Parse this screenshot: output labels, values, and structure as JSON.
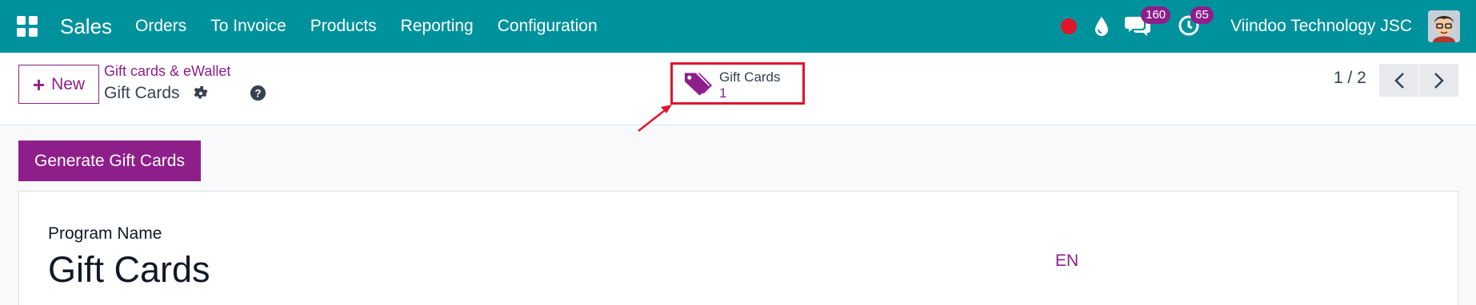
{
  "navbar": {
    "app_name": "Sales",
    "menu": [
      "Orders",
      "To Invoice",
      "Products",
      "Reporting",
      "Configuration"
    ],
    "messages_badge": "160",
    "activities_badge": "65",
    "company": "Viindoo Technology JSC"
  },
  "control_panel": {
    "new_label": "New",
    "breadcrumb_parent": "Gift cards & eWallet",
    "breadcrumb_current": "Gift Cards",
    "smart_button": {
      "label": "Gift Cards",
      "value": "1"
    },
    "pager": "1 / 2"
  },
  "form": {
    "generate_button": "Generate Gift Cards",
    "program_name_label": "Program Name",
    "program_name_value": "Gift Cards",
    "language": "EN"
  },
  "colors": {
    "navbar": "#00929c",
    "primary": "#8e1f8a",
    "highlight": "#e0162b"
  }
}
